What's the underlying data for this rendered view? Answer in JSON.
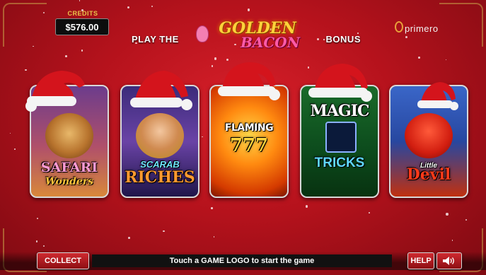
{
  "credits": {
    "label": "CREDITS",
    "value": "$576.00"
  },
  "banner": {
    "prefix": "PLAY THE",
    "logo_word_1": "GOLDEN",
    "logo_word_2": "BACON",
    "suffix": "BONUS"
  },
  "brand": {
    "name": "primero"
  },
  "games": [
    {
      "id": "safari-wonders",
      "title_line_1": "SAFARI",
      "title_line_2": "Wonders"
    },
    {
      "id": "scarab-riches",
      "title_line_1": "SCARAB",
      "title_line_2": "RICHES"
    },
    {
      "id": "flaming-7",
      "title_line_1": "FLAMING",
      "title_line_2": "777"
    },
    {
      "id": "magic-tricks",
      "title_line_1": "MAGIC",
      "title_line_2": "TRICKS"
    },
    {
      "id": "little-devil",
      "title_line_1": "Little",
      "title_line_2": "Devil"
    }
  ],
  "bottom": {
    "collect_label": "COLLECT",
    "message": "Touch a GAME LOGO to start the game",
    "help_label": "HELP",
    "sound_icon": "speaker-volume-icon"
  },
  "colors": {
    "background_red": "#b5121c",
    "accent_gold": "#e8c34a",
    "button_red": "#cf2a30"
  }
}
